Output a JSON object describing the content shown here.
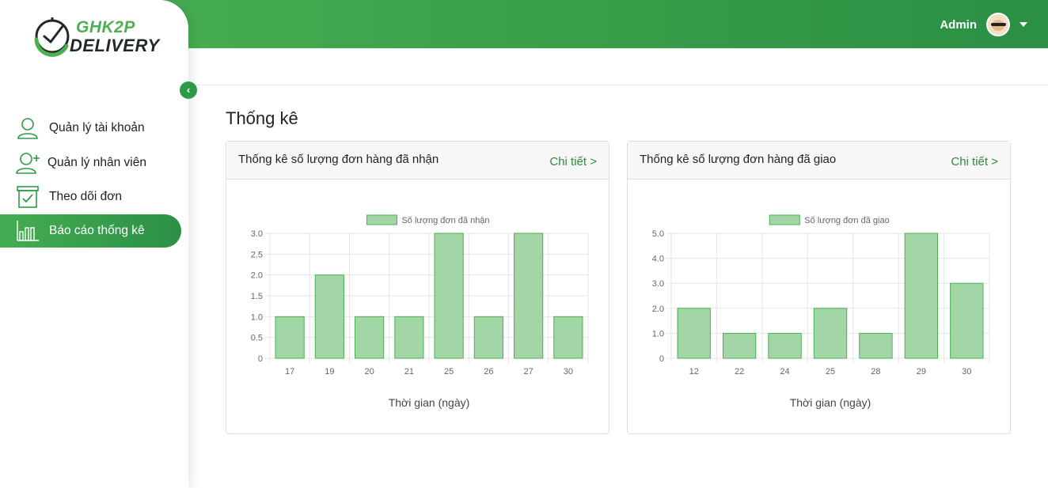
{
  "app": {
    "logo_line1": "GHK2P",
    "logo_line2": "DELIVERY"
  },
  "header": {
    "user_name": "Admin"
  },
  "sidebar": {
    "collapse_icon": "chevron-left-icon",
    "items": [
      {
        "label": "Quản lý tài khoản",
        "icon": "user-icon",
        "active": false
      },
      {
        "label": "Quản lý nhân viên",
        "icon": "user-add-icon",
        "active": false
      },
      {
        "label": "Theo dõi đơn",
        "icon": "checkbox-icon",
        "active": false
      },
      {
        "label": "Báo cáo thống kê",
        "icon": "bar-chart-icon",
        "active": true
      }
    ]
  },
  "page": {
    "title": "Thống kê"
  },
  "cards": [
    {
      "title": "Thống kê số lượng đơn hàng đã nhận",
      "link": "Chi tiết >"
    },
    {
      "title": "Thống kê số lượng đơn hàng đã giao",
      "link": "Chi tiết >"
    }
  ],
  "colors": {
    "accent": "#3aa049",
    "bar_fill": "#a3d6a6",
    "bar_stroke": "#4caf50",
    "link": "#2e8b3d"
  },
  "chart_data": [
    {
      "type": "bar",
      "categories": [
        "17",
        "19",
        "20",
        "21",
        "25",
        "26",
        "27",
        "30"
      ],
      "series": [
        {
          "name": "Số lượng đơn đã nhận",
          "values": [
            1,
            2,
            1,
            1,
            3,
            1,
            3,
            1
          ]
        }
      ],
      "xlabel": "Thời gian (ngày)",
      "ylabel": "",
      "ylim": [
        0,
        3
      ],
      "yticks": [
        "0",
        "0.5",
        "1.0",
        "1.5",
        "2.0",
        "2.5",
        "3.0"
      ],
      "ytick_values": [
        0,
        0.5,
        1,
        1.5,
        2,
        2.5,
        3
      ],
      "grid": true,
      "legend": "top-center"
    },
    {
      "type": "bar",
      "categories": [
        "12",
        "22",
        "24",
        "25",
        "28",
        "29",
        "30"
      ],
      "series": [
        {
          "name": "Số lượng đơn đã giao",
          "values": [
            2,
            1,
            1,
            2,
            1,
            5,
            3
          ]
        }
      ],
      "xlabel": "Thời gian (ngày)",
      "ylabel": "",
      "ylim": [
        0,
        5
      ],
      "yticks": [
        "0",
        "1.0",
        "2.0",
        "3.0",
        "4.0",
        "5.0"
      ],
      "ytick_values": [
        0,
        1,
        2,
        3,
        4,
        5
      ],
      "grid": true,
      "legend": "top-center"
    }
  ]
}
